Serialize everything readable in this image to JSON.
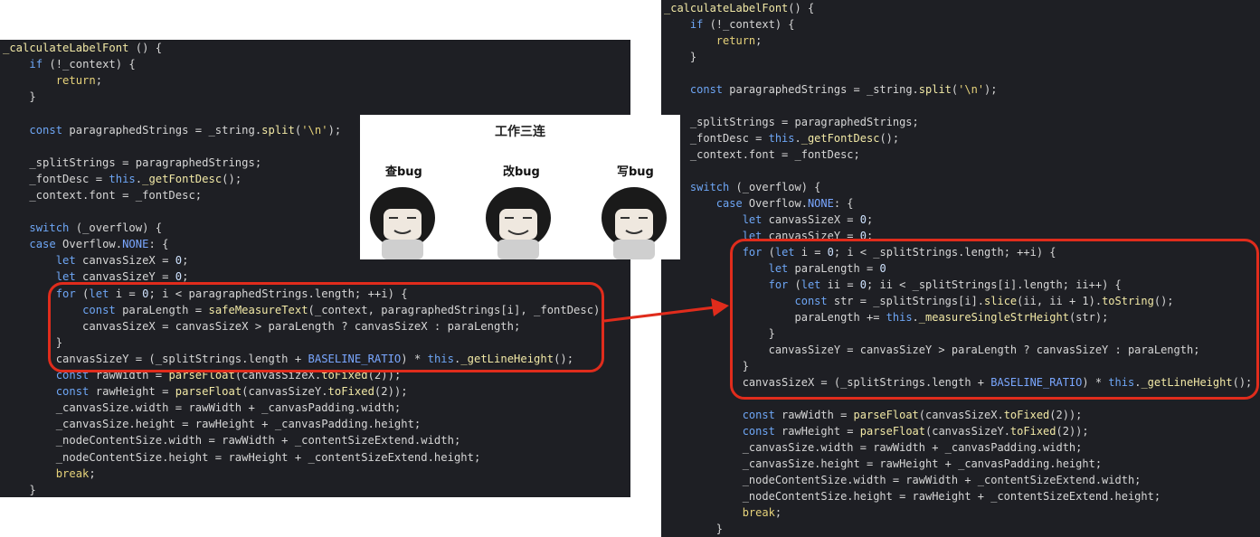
{
  "left_code": [
    {
      "segs": [
        [
          "_calculateLabelFont",
          "t-fn"
        ],
        [
          " () {",
          "t-id"
        ]
      ]
    },
    {
      "segs": [
        [
          "    ",
          ""
        ],
        [
          "if",
          "t-kw"
        ],
        [
          " (!_context) {",
          "t-id"
        ]
      ]
    },
    {
      "segs": [
        [
          "        ",
          ""
        ],
        [
          "return",
          "t-ret"
        ],
        [
          ";",
          "t-id"
        ]
      ]
    },
    {
      "segs": [
        [
          "    }",
          "t-id"
        ]
      ]
    },
    {
      "segs": [
        [
          "",
          ""
        ]
      ]
    },
    {
      "segs": [
        [
          "    ",
          ""
        ],
        [
          "const",
          "t-kw"
        ],
        [
          " paragraphedStrings = _string.",
          "t-id"
        ],
        [
          "split",
          "t-fn"
        ],
        [
          "(",
          "t-id"
        ],
        [
          "'\\n'",
          "t-str"
        ],
        [
          ");",
          "t-id"
        ]
      ]
    },
    {
      "segs": [
        [
          "",
          ""
        ]
      ]
    },
    {
      "segs": [
        [
          "    _splitStrings = paragraphedStrings;",
          "t-id"
        ]
      ]
    },
    {
      "segs": [
        [
          "    _fontDesc = ",
          "t-id"
        ],
        [
          "this",
          "t-kw"
        ],
        [
          ".",
          "t-id"
        ],
        [
          "_getFontDesc",
          "t-fn"
        ],
        [
          "();",
          "t-id"
        ]
      ]
    },
    {
      "segs": [
        [
          "    _context.font = _fontDesc;",
          "t-id"
        ]
      ]
    },
    {
      "segs": [
        [
          "",
          ""
        ]
      ]
    },
    {
      "segs": [
        [
          "    ",
          ""
        ],
        [
          "switch",
          "t-kw"
        ],
        [
          " (_overflow) {",
          "t-id"
        ]
      ]
    },
    {
      "segs": [
        [
          "    ",
          ""
        ],
        [
          "case",
          "t-kw"
        ],
        [
          " Overflow.",
          "t-id"
        ],
        [
          "NONE",
          "t-cls"
        ],
        [
          ": {",
          "t-id"
        ]
      ]
    },
    {
      "segs": [
        [
          "        ",
          ""
        ],
        [
          "let",
          "t-kw"
        ],
        [
          " canvasSizeX = ",
          "t-id"
        ],
        [
          "0",
          "t-num"
        ],
        [
          ";",
          "t-id"
        ]
      ]
    },
    {
      "segs": [
        [
          "        ",
          ""
        ],
        [
          "let",
          "t-kw"
        ],
        [
          " canvasSizeY = ",
          "t-id"
        ],
        [
          "0",
          "t-num"
        ],
        [
          ";",
          "t-id"
        ]
      ]
    },
    {
      "segs": [
        [
          "        ",
          ""
        ],
        [
          "for",
          "t-kw"
        ],
        [
          " (",
          "t-id"
        ],
        [
          "let",
          "t-kw"
        ],
        [
          " i = ",
          "t-id"
        ],
        [
          "0",
          "t-num"
        ],
        [
          "; i < paragraphedStrings.length; ++i) {",
          "t-id"
        ]
      ]
    },
    {
      "segs": [
        [
          "            ",
          ""
        ],
        [
          "const",
          "t-kw"
        ],
        [
          " paraLength = ",
          "t-id"
        ],
        [
          "safeMeasureText",
          "t-fn"
        ],
        [
          "(_context, paragraphedStrings[i], _fontDesc);",
          "t-id"
        ]
      ]
    },
    {
      "segs": [
        [
          "            canvasSizeX = canvasSizeX > paraLength ? canvasSizeX : paraLength;",
          "t-id"
        ]
      ]
    },
    {
      "segs": [
        [
          "        }",
          "t-id"
        ]
      ]
    },
    {
      "segs": [
        [
          "        canvasSizeY = (_splitStrings.length + ",
          "t-id"
        ],
        [
          "BASELINE_RATIO",
          "t-cls"
        ],
        [
          ") * ",
          "t-id"
        ],
        [
          "this",
          "t-kw"
        ],
        [
          ".",
          "t-id"
        ],
        [
          "_getLineHeight",
          "t-fn"
        ],
        [
          "();",
          "t-id"
        ]
      ]
    },
    {
      "segs": [
        [
          "        ",
          ""
        ],
        [
          "const",
          "t-kw"
        ],
        [
          " rawWidth = ",
          "t-id"
        ],
        [
          "parseFloat",
          "t-fn"
        ],
        [
          "(canvasSizeX.",
          "t-id"
        ],
        [
          "toFixed",
          "t-fn"
        ],
        [
          "(2));",
          "t-id"
        ]
      ]
    },
    {
      "segs": [
        [
          "        ",
          ""
        ],
        [
          "const",
          "t-kw"
        ],
        [
          " rawHeight = ",
          "t-id"
        ],
        [
          "parseFloat",
          "t-fn"
        ],
        [
          "(canvasSizeY.",
          "t-id"
        ],
        [
          "toFixed",
          "t-fn"
        ],
        [
          "(2));",
          "t-id"
        ]
      ]
    },
    {
      "segs": [
        [
          "        _canvasSize.width = rawWidth + _canvasPadding.width;",
          "t-id"
        ]
      ]
    },
    {
      "segs": [
        [
          "        _canvasSize.height = rawHeight + _canvasPadding.height;",
          "t-id"
        ]
      ]
    },
    {
      "segs": [
        [
          "        _nodeContentSize.width = rawWidth + _contentSizeExtend.width;",
          "t-id"
        ]
      ]
    },
    {
      "segs": [
        [
          "        _nodeContentSize.height = rawHeight + _contentSizeExtend.height;",
          "t-id"
        ]
      ]
    },
    {
      "segs": [
        [
          "        ",
          ""
        ],
        [
          "break",
          "t-ret"
        ],
        [
          ";",
          "t-id"
        ]
      ]
    },
    {
      "segs": [
        [
          "    }",
          "t-id"
        ]
      ]
    }
  ],
  "right_code": [
    {
      "segs": [
        [
          "_calculateLabelFont",
          "t-fn"
        ],
        [
          "() {",
          "t-id"
        ]
      ]
    },
    {
      "segs": [
        [
          "    ",
          ""
        ],
        [
          "if",
          "t-kw"
        ],
        [
          " (!_context) {",
          "t-id"
        ]
      ]
    },
    {
      "segs": [
        [
          "        ",
          ""
        ],
        [
          "return",
          "t-ret"
        ],
        [
          ";",
          "t-id"
        ]
      ]
    },
    {
      "segs": [
        [
          "    }",
          "t-id"
        ]
      ]
    },
    {
      "segs": [
        [
          "",
          ""
        ]
      ]
    },
    {
      "segs": [
        [
          "    ",
          ""
        ],
        [
          "const",
          "t-kw"
        ],
        [
          " paragraphedStrings = _string.",
          "t-id"
        ],
        [
          "split",
          "t-fn"
        ],
        [
          "(",
          "t-id"
        ],
        [
          "'\\n'",
          "t-str"
        ],
        [
          ");",
          "t-id"
        ]
      ]
    },
    {
      "segs": [
        [
          "",
          ""
        ]
      ]
    },
    {
      "segs": [
        [
          "    _splitStrings = paragraphedStrings;",
          "t-id"
        ]
      ]
    },
    {
      "segs": [
        [
          "    _fontDesc = ",
          "t-id"
        ],
        [
          "this",
          "t-kw"
        ],
        [
          ".",
          "t-id"
        ],
        [
          "_getFontDesc",
          "t-fn"
        ],
        [
          "();",
          "t-id"
        ]
      ]
    },
    {
      "segs": [
        [
          "    _context.font = _fontDesc;",
          "t-id"
        ]
      ]
    },
    {
      "segs": [
        [
          "",
          ""
        ]
      ]
    },
    {
      "segs": [
        [
          "    ",
          ""
        ],
        [
          "switch",
          "t-kw"
        ],
        [
          " (_overflow) {",
          "t-id"
        ]
      ]
    },
    {
      "segs": [
        [
          "        ",
          ""
        ],
        [
          "case",
          "t-kw"
        ],
        [
          " Overflow.",
          "t-id"
        ],
        [
          "NONE",
          "t-cls"
        ],
        [
          ": {",
          "t-id"
        ]
      ]
    },
    {
      "segs": [
        [
          "            ",
          ""
        ],
        [
          "let",
          "t-kw"
        ],
        [
          " canvasSizeX = ",
          "t-id"
        ],
        [
          "0",
          "t-num"
        ],
        [
          ";",
          "t-id"
        ]
      ]
    },
    {
      "segs": [
        [
          "            ",
          ""
        ],
        [
          "let",
          "t-kw"
        ],
        [
          " canvasSizeY = ",
          "t-id"
        ],
        [
          "0",
          "t-num"
        ],
        [
          ";",
          "t-id"
        ]
      ]
    },
    {
      "segs": [
        [
          "            ",
          ""
        ],
        [
          "for",
          "t-kw"
        ],
        [
          " (",
          "t-id"
        ],
        [
          "let",
          "t-kw"
        ],
        [
          " i = ",
          "t-id"
        ],
        [
          "0",
          "t-num"
        ],
        [
          "; i < _splitStrings.length; ++i) {",
          "t-id"
        ]
      ]
    },
    {
      "segs": [
        [
          "                ",
          ""
        ],
        [
          "let",
          "t-kw"
        ],
        [
          " paraLength = ",
          "t-id"
        ],
        [
          "0",
          "t-num"
        ]
      ]
    },
    {
      "segs": [
        [
          "                ",
          ""
        ],
        [
          "for",
          "t-kw"
        ],
        [
          " (",
          "t-id"
        ],
        [
          "let",
          "t-kw"
        ],
        [
          " ii = ",
          "t-id"
        ],
        [
          "0",
          "t-num"
        ],
        [
          "; ii < _splitStrings[i].length; ii++) {",
          "t-id"
        ]
      ]
    },
    {
      "segs": [
        [
          "                    ",
          ""
        ],
        [
          "const",
          "t-kw"
        ],
        [
          " str = _splitStrings[i].",
          "t-id"
        ],
        [
          "slice",
          "t-fn"
        ],
        [
          "(ii, ii + 1).",
          "t-id"
        ],
        [
          "toString",
          "t-fn"
        ],
        [
          "();",
          "t-id"
        ]
      ]
    },
    {
      "segs": [
        [
          "                    paraLength += ",
          "t-id"
        ],
        [
          "this",
          "t-kw"
        ],
        [
          ".",
          "t-id"
        ],
        [
          "_measureSingleStrHeight",
          "t-fn"
        ],
        [
          "(str);",
          "t-id"
        ]
      ]
    },
    {
      "segs": [
        [
          "                }",
          "t-id"
        ]
      ]
    },
    {
      "segs": [
        [
          "                canvasSizeY = canvasSizeY > paraLength ? canvasSizeY : paraLength;",
          "t-id"
        ]
      ]
    },
    {
      "segs": [
        [
          "            }",
          "t-id"
        ]
      ]
    },
    {
      "segs": [
        [
          "            canvasSizeX = (_splitStrings.length + ",
          "t-id"
        ],
        [
          "BASELINE_RATIO",
          "t-cls"
        ],
        [
          ") * ",
          "t-id"
        ],
        [
          "this",
          "t-kw"
        ],
        [
          ".",
          "t-id"
        ],
        [
          "_getLineHeight",
          "t-fn"
        ],
        [
          "();",
          "t-id"
        ]
      ]
    },
    {
      "segs": [
        [
          "",
          ""
        ]
      ]
    },
    {
      "segs": [
        [
          "            ",
          ""
        ],
        [
          "const",
          "t-kw"
        ],
        [
          " rawWidth = ",
          "t-id"
        ],
        [
          "parseFloat",
          "t-fn"
        ],
        [
          "(canvasSizeX.",
          "t-id"
        ],
        [
          "toFixed",
          "t-fn"
        ],
        [
          "(2));",
          "t-id"
        ]
      ]
    },
    {
      "segs": [
        [
          "            ",
          ""
        ],
        [
          "const",
          "t-kw"
        ],
        [
          " rawHeight = ",
          "t-id"
        ],
        [
          "parseFloat",
          "t-fn"
        ],
        [
          "(canvasSizeY.",
          "t-id"
        ],
        [
          "toFixed",
          "t-fn"
        ],
        [
          "(2));",
          "t-id"
        ]
      ]
    },
    {
      "segs": [
        [
          "            _canvasSize.width = rawWidth + _canvasPadding.width;",
          "t-id"
        ]
      ]
    },
    {
      "segs": [
        [
          "            _canvasSize.height = rawHeight + _canvasPadding.height;",
          "t-id"
        ]
      ]
    },
    {
      "segs": [
        [
          "            _nodeContentSize.width = rawWidth + _contentSizeExtend.width;",
          "t-id"
        ]
      ]
    },
    {
      "segs": [
        [
          "            _nodeContentSize.height = rawHeight + _contentSizeExtend.height;",
          "t-id"
        ]
      ]
    },
    {
      "segs": [
        [
          "            ",
          ""
        ],
        [
          "break",
          "t-ret"
        ],
        [
          ";",
          "t-id"
        ]
      ]
    },
    {
      "segs": [
        [
          "        }",
          "t-id"
        ]
      ]
    }
  ],
  "meme": {
    "title": "工作三连",
    "labels": [
      "查bug",
      "改bug",
      "写bug"
    ]
  },
  "colors": {
    "highlight": "#e02c1c",
    "editor_bg": "#1e1f24"
  }
}
